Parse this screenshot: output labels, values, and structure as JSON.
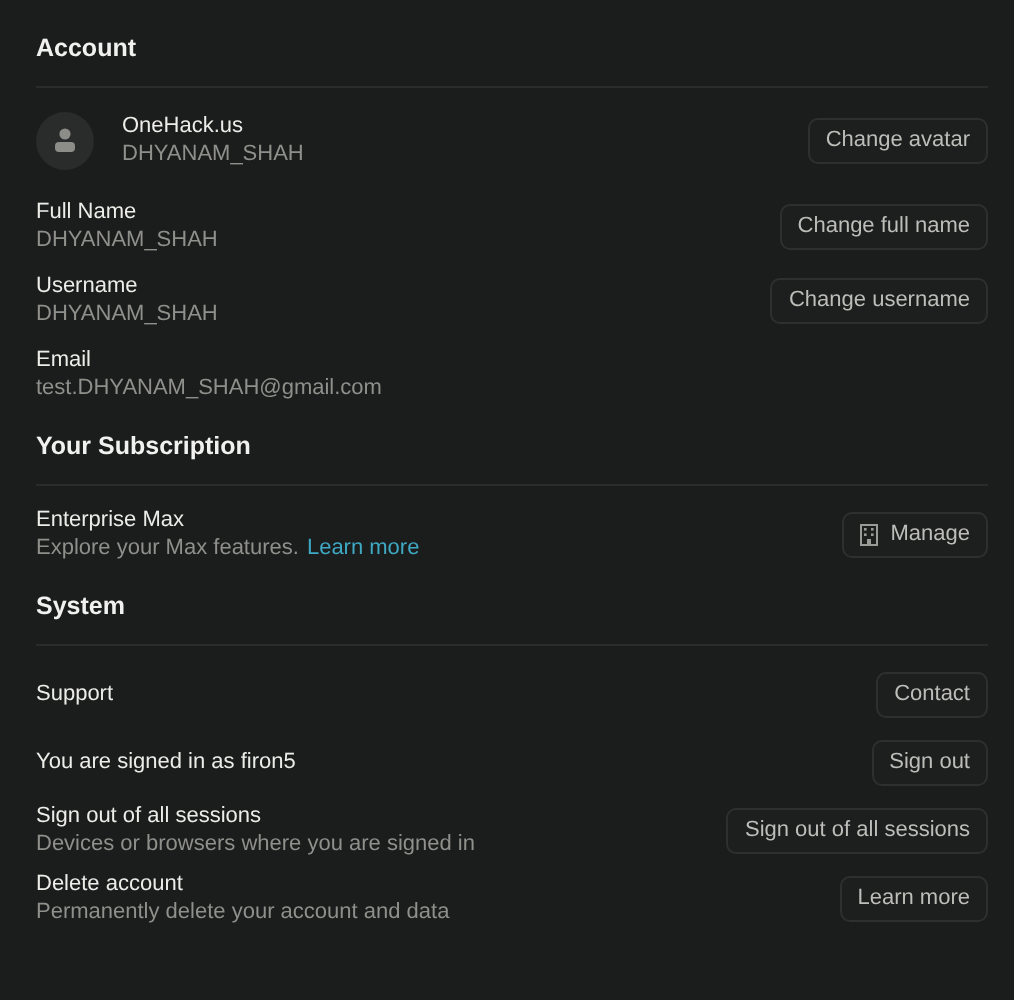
{
  "sections": [
    {
      "heading": "Account",
      "rows": [
        {
          "kind": "profile",
          "title": "OneHack.us",
          "subtitle": "DHYANAM_SHAH",
          "button": "Change avatar"
        },
        {
          "kind": "info",
          "title": "Full Name",
          "subtitle": "DHYANAM_SHAH",
          "button": "Change full name"
        },
        {
          "kind": "info",
          "title": "Username",
          "subtitle": "DHYANAM_SHAH",
          "button": "Change username"
        },
        {
          "kind": "info",
          "title": "Email",
          "subtitle": "test.DHYANAM_SHAH@gmail.com"
        }
      ]
    },
    {
      "heading": "Your Subscription",
      "rows": [
        {
          "kind": "plan",
          "title": "Enterprise Max",
          "subtitle": "Explore your Max features.",
          "link": "Learn more",
          "button": "Manage"
        }
      ]
    },
    {
      "heading": "System",
      "rows": [
        {
          "kind": "info",
          "title": "Support",
          "button": "Contact"
        },
        {
          "kind": "info",
          "title": "You are signed in as firon5",
          "button": "Sign out"
        },
        {
          "kind": "info",
          "title": "Sign out of all sessions",
          "subtitle": "Devices or browsers where you are signed in",
          "button": "Sign out of all sessions"
        },
        {
          "kind": "info",
          "title": "Delete account",
          "subtitle": "Permanently delete your account and data",
          "button": "Learn more"
        }
      ]
    }
  ]
}
